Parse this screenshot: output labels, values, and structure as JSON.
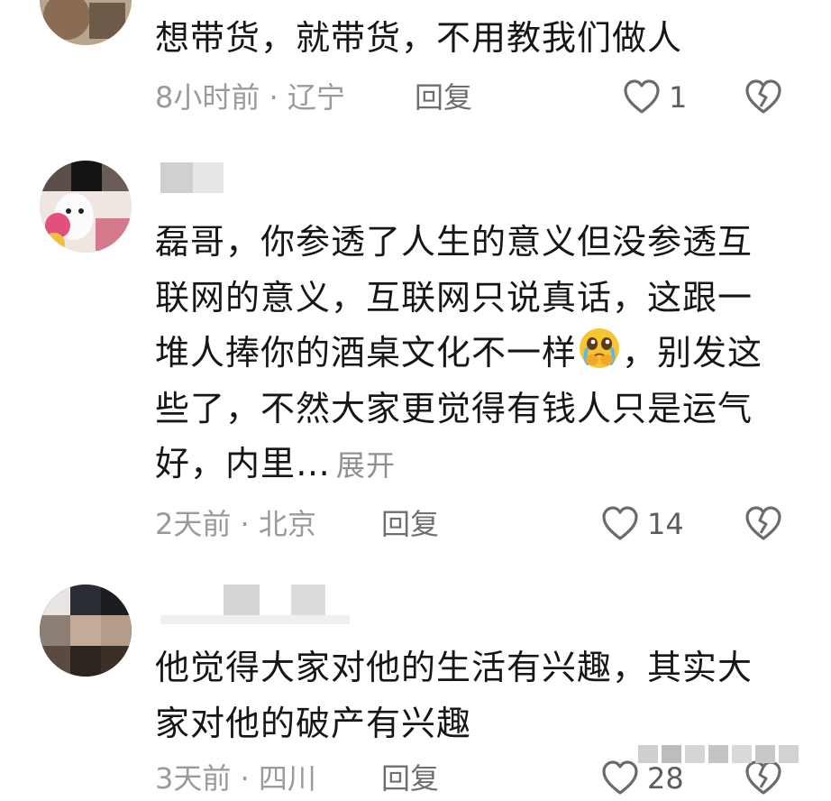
{
  "comments": [
    {
      "text": "想带货，就带货，不用教我们做人",
      "time": "8小时前",
      "location": "辽宁",
      "reply_label": "回复",
      "likes": "1"
    },
    {
      "text": "磊哥，你参透了人生的意义但没参透互联网的意义，互联网只说真话，这跟一堆人捧你的酒桌文化不一样",
      "emoji": "crying-pleading-emoji",
      "text_after_emoji": "，别发这些了，不然大家更觉得有钱人只是运气好，内里…",
      "expand_label": "展开",
      "time": "2天前",
      "location": "北京",
      "reply_label": "回复",
      "likes": "14"
    },
    {
      "text": "他觉得大家对他的生活有兴趣，其实大家对他的破产有兴趣",
      "time": "3天前",
      "location": "四川",
      "reply_label": "回复",
      "likes": "28"
    }
  ],
  "meta_separator": " · ",
  "colors": {
    "text": "#161616",
    "meta": "#9a9a9a",
    "reply": "#6f6f6f",
    "icon": "#6b6b6b"
  }
}
